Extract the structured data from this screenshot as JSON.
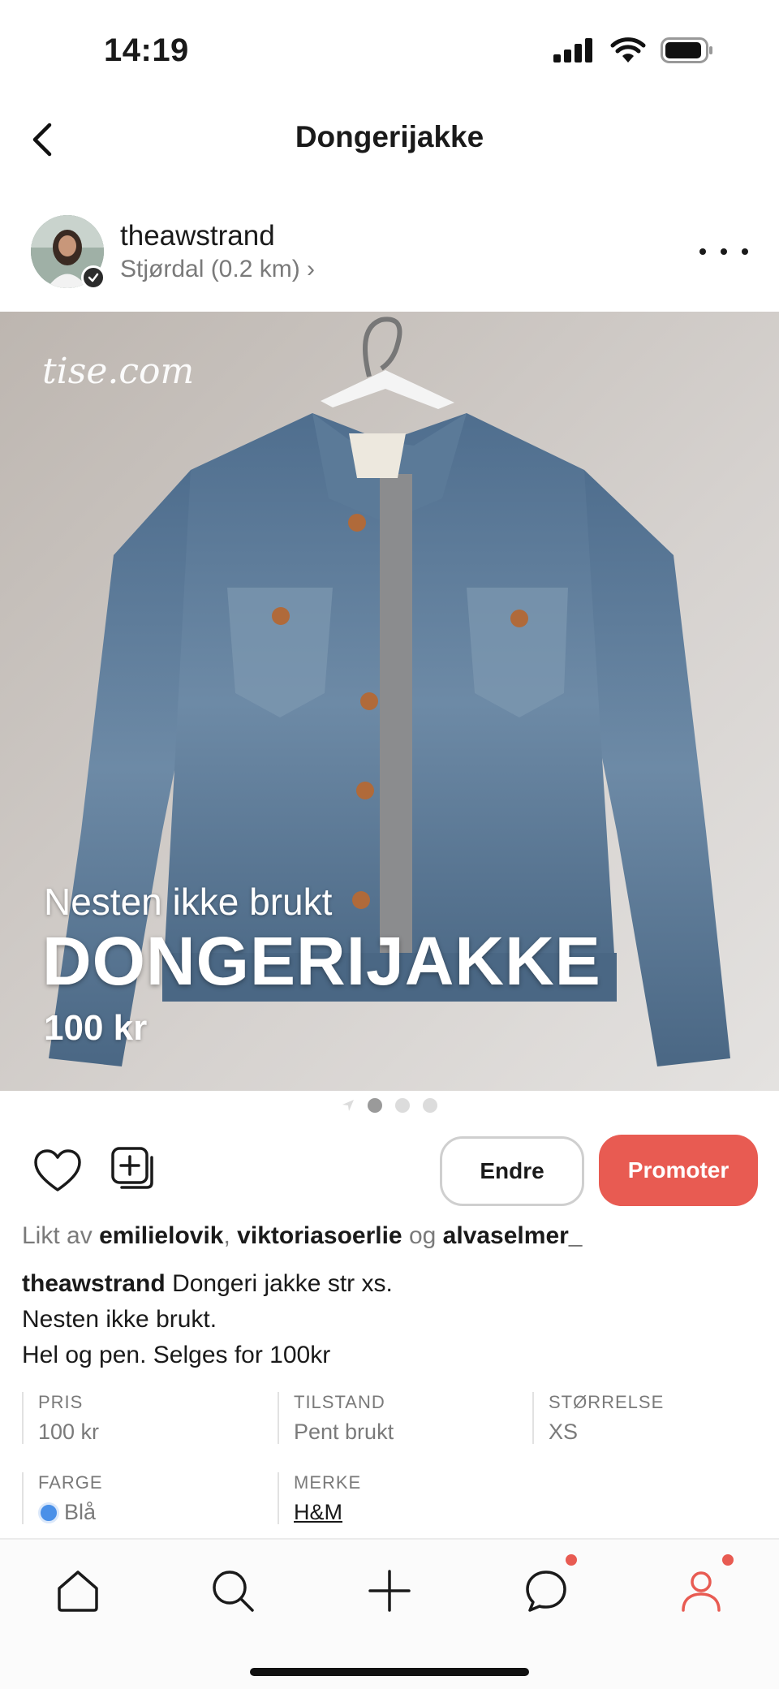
{
  "status_bar": {
    "time": "14:19"
  },
  "nav": {
    "title": "Dongerijakke"
  },
  "seller": {
    "username": "theawstrand",
    "location": "Stjørdal (0.2 km) ›"
  },
  "photo": {
    "watermark": "tise.com",
    "condition": "Nesten ikke brukt",
    "title": "DONGERIJAKKE",
    "price": "100 kr",
    "page_count": 3,
    "active_page": 1
  },
  "actions": {
    "edit_label": "Endre",
    "promote_label": "Promoter"
  },
  "likes": {
    "prefix": "Likt av",
    "users": [
      "emilielovik",
      "viktoriasoerlie",
      "alvaselmer_"
    ],
    "separator": ",",
    "conjunction": "og"
  },
  "description": {
    "author": "theawstrand",
    "line1": "Dongeri jakke str xs.",
    "line2": "Nesten ikke brukt.",
    "line3": "Hel og pen. Selges for 100kr"
  },
  "attributes": {
    "price": {
      "label": "PRIS",
      "value": "100 kr"
    },
    "condition": {
      "label": "TILSTAND",
      "value": "Pent brukt"
    },
    "size": {
      "label": "STØRRELSE",
      "value": "XS"
    },
    "color": {
      "label": "FARGE",
      "value": "Blå",
      "swatch": "#4a90e8"
    },
    "brand": {
      "label": "MERKE",
      "value": "H&M"
    }
  },
  "tabbar": {
    "items": [
      "home-icon",
      "search-icon",
      "plus-icon",
      "chat-icon",
      "profile-icon"
    ],
    "accent": "#e85b52"
  },
  "colors": {
    "accent": "#e85b52",
    "text": "#1a1a1a",
    "muted": "#7a7a7a"
  }
}
